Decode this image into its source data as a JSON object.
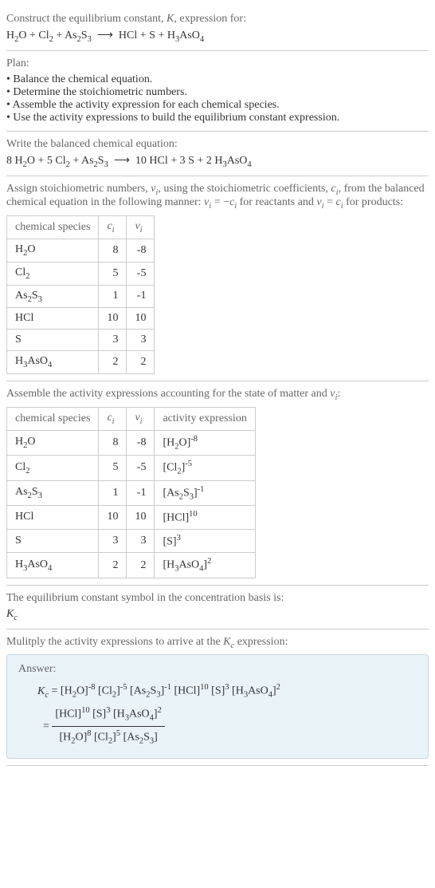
{
  "chart_data": [
    {
      "type": "table",
      "title": "Stoichiometric numbers",
      "columns": [
        "chemical species",
        "c_i",
        "ν_i"
      ],
      "rows": [
        [
          "H2O",
          8,
          -8
        ],
        [
          "Cl2",
          5,
          -5
        ],
        [
          "As2S3",
          1,
          -1
        ],
        [
          "HCl",
          10,
          10
        ],
        [
          "S",
          3,
          3
        ],
        [
          "H3AsO4",
          2,
          2
        ]
      ]
    },
    {
      "type": "table",
      "title": "Activity expressions",
      "columns": [
        "chemical species",
        "c_i",
        "ν_i",
        "activity expression"
      ],
      "rows": [
        [
          "H2O",
          8,
          -8,
          "[H2O]^-8"
        ],
        [
          "Cl2",
          5,
          -5,
          "[Cl2]^-5"
        ],
        [
          "As2S3",
          1,
          -1,
          "[As2S3]^-1"
        ],
        [
          "HCl",
          10,
          10,
          "[HCl]^10"
        ],
        [
          "S",
          3,
          3,
          "[S]^3"
        ],
        [
          "H3AsO4",
          2,
          2,
          "[H3AsO4]^2"
        ]
      ]
    }
  ],
  "s1": {
    "prompt": "Construct the equilibrium constant, K, expression for:",
    "equation": "H₂O + Cl₂ + As₂S₃  ⟶  HCl + S + H₃AsO₄"
  },
  "s2": {
    "title": "Plan:",
    "b1": "Balance the chemical equation.",
    "b2": "Determine the stoichiometric numbers.",
    "b3": "Assemble the activity expression for each chemical species.",
    "b4": "Use the activity expressions to build the equilibrium constant expression."
  },
  "s3": {
    "prompt": "Write the balanced chemical equation:",
    "equation": "8 H₂O + 5 Cl₂ + As₂S₃  ⟶  10 HCl + 3 S + 2 H₃AsO₄"
  },
  "s4": {
    "intro1": "Assign stoichiometric numbers, ",
    "intro2": ", using the stoichiometric coefficients, ",
    "intro3": ", from the balanced chemical equation in the following manner: ",
    "intro4": " for reactants and ",
    "intro5": " for products:",
    "h1": "chemical species",
    "h2": "cᵢ",
    "h3": "νᵢ",
    "r1c1": "H₂O",
    "r1c2": "8",
    "r1c3": "-8",
    "r2c1": "Cl₂",
    "r2c2": "5",
    "r2c3": "-5",
    "r3c1": "As₂S₃",
    "r3c2": "1",
    "r3c3": "-1",
    "r4c1": "HCl",
    "r4c2": "10",
    "r4c3": "10",
    "r5c1": "S",
    "r5c2": "3",
    "r5c3": "3",
    "r6c1": "H₃AsO₄",
    "r6c2": "2",
    "r6c3": "2"
  },
  "s5": {
    "prompt": "Assemble the activity expressions accounting for the state of matter and νᵢ:",
    "h1": "chemical species",
    "h2": "cᵢ",
    "h3": "νᵢ",
    "h4": "activity expression",
    "r1c1": "H₂O",
    "r1c2": "8",
    "r1c3": "-8",
    "r1c4": "[H₂O]⁻⁸",
    "r2c1": "Cl₂",
    "r2c2": "5",
    "r2c3": "-5",
    "r2c4": "[Cl₂]⁻⁵",
    "r3c1": "As₂S₃",
    "r3c2": "1",
    "r3c3": "-1",
    "r3c4": "[As₂S₃]⁻¹",
    "r4c1": "HCl",
    "r4c2": "10",
    "r4c3": "10",
    "r4c4": "[HCl]¹⁰",
    "r5c1": "S",
    "r5c2": "3",
    "r5c3": "3",
    "r5c4": "[S]³",
    "r6c1": "H₃AsO₄",
    "r6c2": "2",
    "r6c3": "2",
    "r6c4": "[H₃AsO₄]²"
  },
  "s6": {
    "prompt": "The equilibrium constant symbol in the concentration basis is:",
    "symbol": "K_c"
  },
  "s7": {
    "prompt": "Mulitply the activity expressions to arrive at the K_c expression:"
  },
  "answer": {
    "label": "Answer:",
    "line1": "K_c = [H₂O]⁻⁸ [Cl₂]⁻⁵ [As₂S₃]⁻¹ [HCl]¹⁰ [S]³ [H₃AsO₄]²",
    "eq": "=",
    "num": "[HCl]¹⁰ [S]³ [H₃AsO₄]²",
    "den": "[H₂O]⁸ [Cl₂]⁵ [As₂S₃]"
  }
}
